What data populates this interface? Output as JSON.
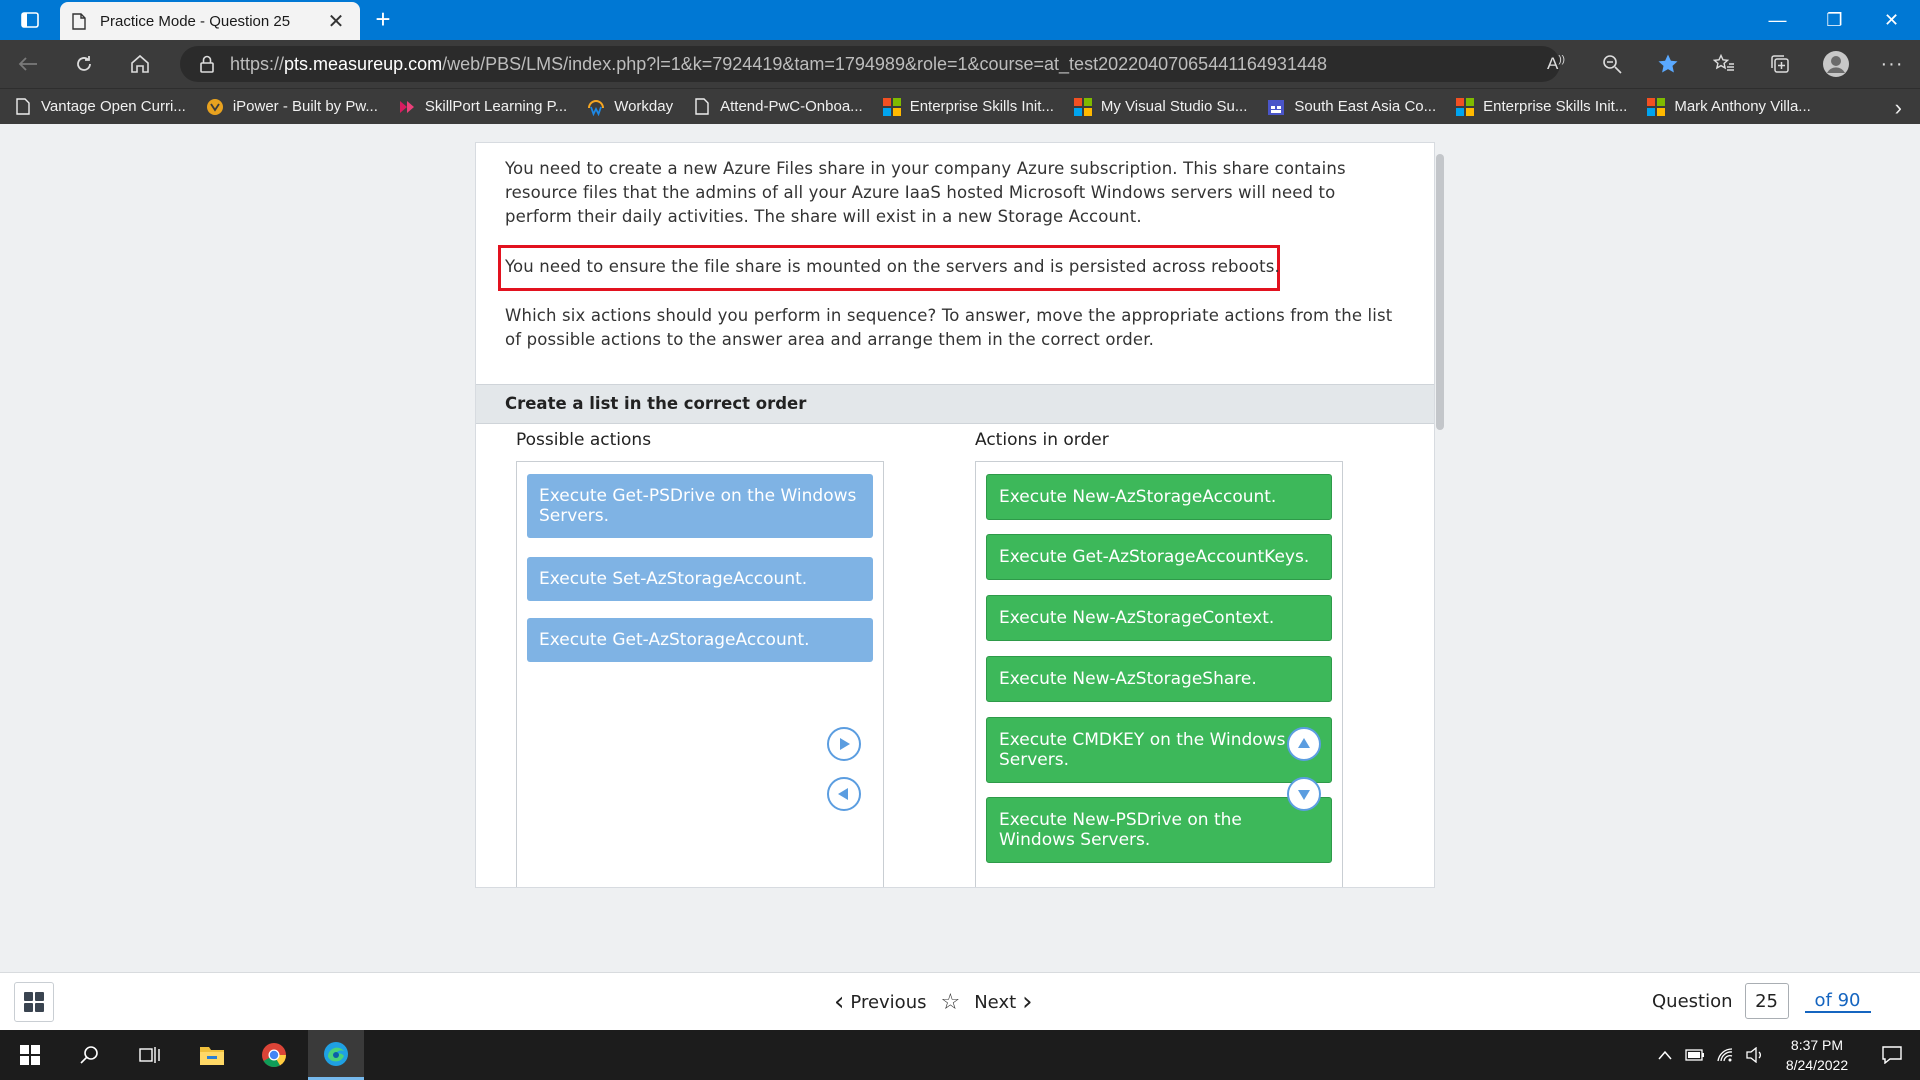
{
  "browser": {
    "tab_title": "Practice Mode - Question 25",
    "tab_close": "✕",
    "new_tab": "+",
    "url_prefix": "https://",
    "url_host": "pts.measureup.com",
    "url_path": "/web/PBS/LMS/index.php?l=1&k=7924419&tam=1794989&role=1&course=at_test20220407065441164931448"
  },
  "favorites": [
    {
      "label": "Vantage Open Curri...",
      "icon": "page-icon"
    },
    {
      "label": "iPower - Built by Pw...",
      "icon": "ipower-icon"
    },
    {
      "label": "SkillPort Learning P...",
      "icon": "skillport-icon"
    },
    {
      "label": "Workday",
      "icon": "workday-icon"
    },
    {
      "label": "Attend-PwC-Onboa...",
      "icon": "page-icon"
    },
    {
      "label": "Enterprise Skills Init...",
      "icon": "microsoft-icon"
    },
    {
      "label": "My Visual Studio Su...",
      "icon": "microsoft-icon"
    },
    {
      "label": "South East Asia Co...",
      "icon": "calendar-icon"
    },
    {
      "label": "Enterprise Skills Init...",
      "icon": "microsoft-icon"
    },
    {
      "label": "Mark Anthony Villa...",
      "icon": "microsoft-icon"
    }
  ],
  "question": {
    "p1": "You need to create a new Azure Files share in your company Azure subscription. This share contains resource files that the admins of all your Azure IaaS hosted Microsoft Windows servers will need to perform their daily activities. The share will exist in a new Storage Account.",
    "p2": "You need to ensure the file share is mounted on the servers and is persisted across reboots.",
    "p3": "Which six actions should you perform in sequence? To answer, move the appropriate actions from the list of possible actions to the answer area and arrange them in the correct order.",
    "section_title": "Create a list in the correct order",
    "possible_title": "Possible actions",
    "order_title": "Actions in order",
    "possible_actions": [
      "Execute Get-PSDrive on the Windows Servers.",
      "Execute Set-AzStorageAccount.",
      "Execute Get-AzStorageAccount."
    ],
    "ordered_actions": [
      "Execute New-AzStorageAccount.",
      "Execute Get-AzStorageAccountKeys.",
      "Execute New-AzStorageContext.",
      "Execute New-AzStorageShare.",
      "Execute CMDKEY on the Windows Servers.",
      "Execute New-PSDrive on the Windows Servers."
    ]
  },
  "nav": {
    "previous": "Previous",
    "next": "Next",
    "question_label": "Question",
    "question_number": "25",
    "question_total": "of 90"
  },
  "taskbar": {
    "time": "8:37 PM",
    "date": "8/24/2022"
  },
  "colors": {
    "tab_strip": "#0078d4",
    "possible_item": "#7fb3e4",
    "ordered_item": "#3db85a",
    "highlight": "#e2121f"
  }
}
